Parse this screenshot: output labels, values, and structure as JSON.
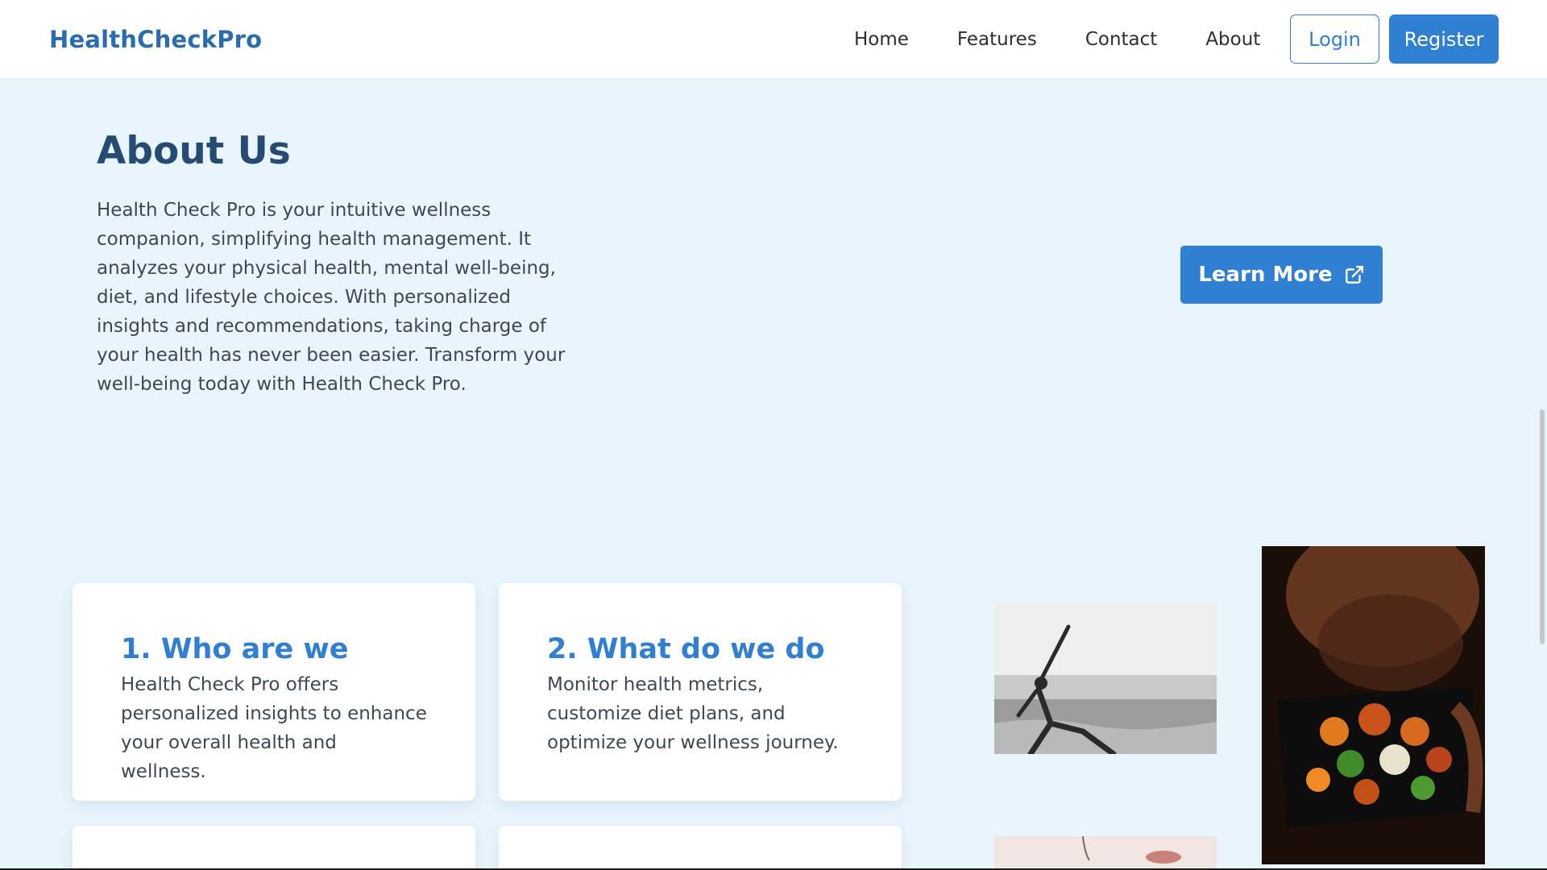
{
  "navbar": {
    "brand": "HealthCheckPro",
    "links": [
      {
        "label": "Home"
      },
      {
        "label": "Features"
      },
      {
        "label": "Contact"
      },
      {
        "label": "About"
      }
    ],
    "login_label": "Login",
    "register_label": "Register"
  },
  "about": {
    "title": "About Us",
    "text": "Health Check Pro is your intuitive wellness companion, simplifying health management. It analyzes your physical health, mental well-being, diet, and lifestyle choices. With personalized insights and recommendations, taking charge of your health has never been easier. Transform your well-being today with Health Check Pro.",
    "learn_more_label": "Learn More",
    "learn_more_icon": "external-link-icon"
  },
  "cards": [
    {
      "title": "1. Who are we",
      "text": "Health Check Pro offers personalized insights to enhance your overall health and wellness."
    },
    {
      "title": "2. What do we do",
      "text": "Monitor health metrics, customize diet plans, and optimize your wellness journey."
    }
  ],
  "colors": {
    "primary": "#2f7fd2",
    "brand": "#2a6cb0",
    "heading": "#264b73",
    "background": "#e9f5fc"
  }
}
